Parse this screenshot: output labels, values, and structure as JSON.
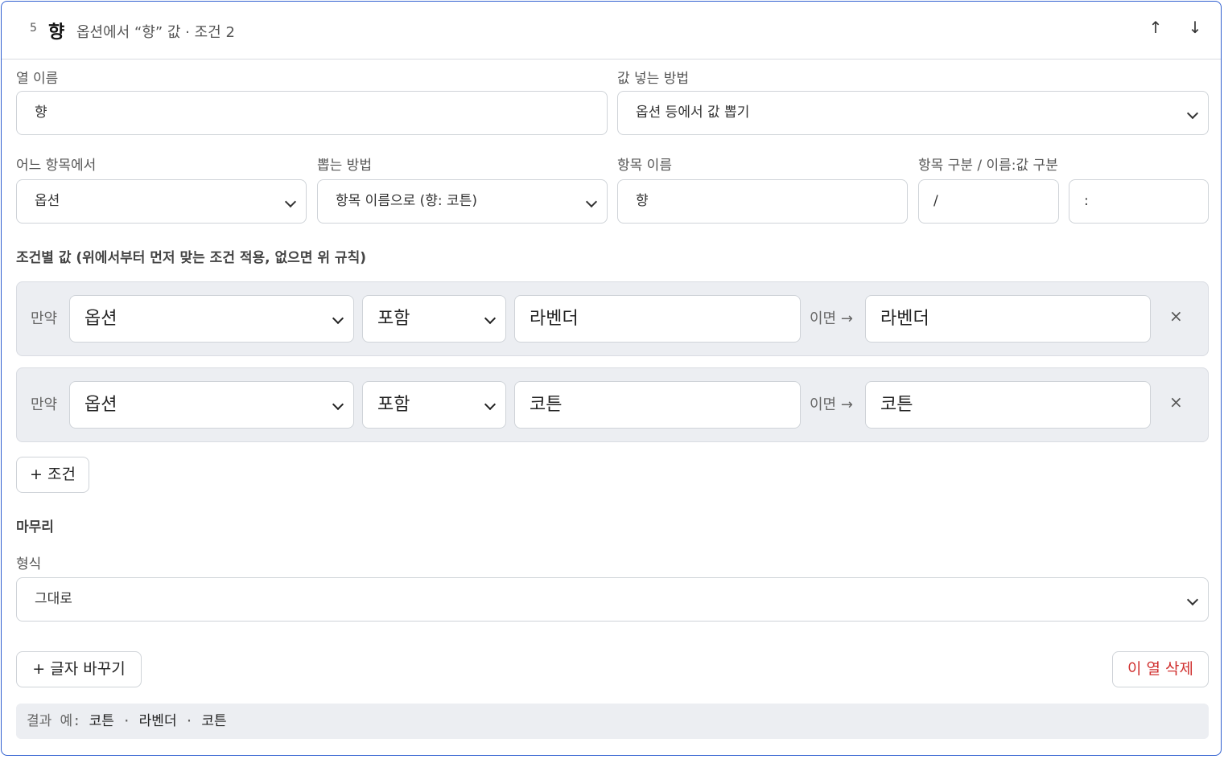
{
  "header": {
    "number": "5",
    "name": "향",
    "description": "옵션에서 “향” 값 · 조건 2",
    "up_icon": "↑",
    "down_icon": "↓"
  },
  "fields": {
    "column_name": {
      "label": "열 이름",
      "value": "향"
    },
    "fill_method": {
      "label": "값 넣는 방법",
      "value": "옵션 등에서 값 뽑기"
    },
    "source": {
      "label": "어느 항목에서",
      "value": "옵션"
    },
    "extract_method": {
      "label": "뽑는 방법",
      "value": "항목 이름으로 (향: 코튼)"
    },
    "item_name": {
      "label": "항목 이름",
      "value": "향"
    },
    "separators": {
      "label": "항목 구분 / 이름:값 구분",
      "item_sep": "/",
      "kv_sep": ":"
    }
  },
  "conditions": {
    "title": "조건별 값 (위에서부터 먼저 맞는 조건 적용, 없으면 위 규칙)",
    "if_label": "만약",
    "then_label": "이면 →",
    "remove_icon": "×",
    "rows": [
      {
        "field": "옵션",
        "operator": "포함",
        "match": "라벤더",
        "result": "라벤더"
      },
      {
        "field": "옵션",
        "operator": "포함",
        "match": "코튼",
        "result": "코튼"
      }
    ],
    "add_label": "+ 조건"
  },
  "finish": {
    "title": "마무리",
    "format_label": "형식",
    "format_value": "그대로"
  },
  "actions": {
    "replace_label": "+ 글자 바꾸기",
    "delete_label": "이 열 삭제"
  },
  "example": {
    "prefix": "결과 예:",
    "values": [
      "코튼",
      "라벤더",
      "코튼"
    ],
    "separator": "·"
  }
}
